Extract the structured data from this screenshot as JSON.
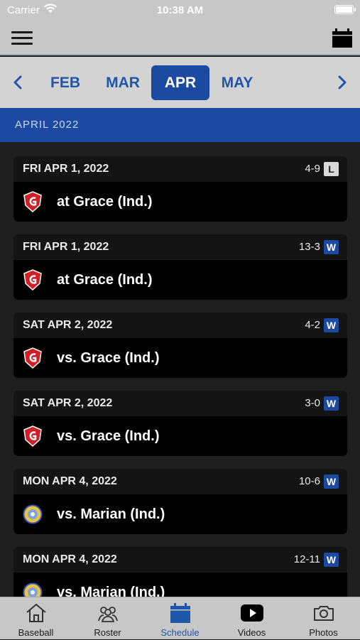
{
  "status_bar": {
    "carrier": "Carrier",
    "time": "10:38 AM"
  },
  "nav": {
    "menu_icon": "hamburger-menu-icon",
    "calendar_icon": "calendar-icon"
  },
  "months": {
    "tabs": [
      {
        "label": "FEB",
        "active": false
      },
      {
        "label": "MAR",
        "active": false
      },
      {
        "label": "APR",
        "active": true
      },
      {
        "label": "MAY",
        "active": false
      }
    ]
  },
  "section": {
    "title": "APRIL 2022"
  },
  "games": [
    {
      "date": "FRI APR 1, 2022",
      "score": "4-9",
      "result": "L",
      "opponent": "at Grace (Ind.)",
      "logo": "grace-logo"
    },
    {
      "date": "FRI APR 1, 2022",
      "score": "13-3",
      "result": "W",
      "opponent": "at Grace (Ind.)",
      "logo": "grace-logo"
    },
    {
      "date": "SAT APR 2, 2022",
      "score": "4-2",
      "result": "W",
      "opponent": "vs. Grace (Ind.)",
      "logo": "grace-logo"
    },
    {
      "date": "SAT APR 2, 2022",
      "score": "3-0",
      "result": "W",
      "opponent": "vs. Grace (Ind.)",
      "logo": "grace-logo"
    },
    {
      "date": "MON APR 4, 2022",
      "score": "10-6",
      "result": "W",
      "opponent": "vs. Marian (Ind.)",
      "logo": "marian-logo"
    },
    {
      "date": "MON APR 4, 2022",
      "score": "12-11",
      "result": "W",
      "opponent": "vs. Marian (Ind.)",
      "logo": "marian-logo"
    }
  ],
  "tabs": [
    {
      "label": "Baseball",
      "icon": "home-icon",
      "active": false
    },
    {
      "label": "Roster",
      "icon": "roster-icon",
      "active": false
    },
    {
      "label": "Schedule",
      "icon": "calendar-icon",
      "active": true
    },
    {
      "label": "Videos",
      "icon": "play-icon",
      "active": false
    },
    {
      "label": "Photos",
      "icon": "camera-icon",
      "active": false
    }
  ],
  "colors": {
    "accent": "#1c4aa1",
    "win_badge": "#1c4aa1",
    "loss_badge": "#d9d9d9"
  }
}
